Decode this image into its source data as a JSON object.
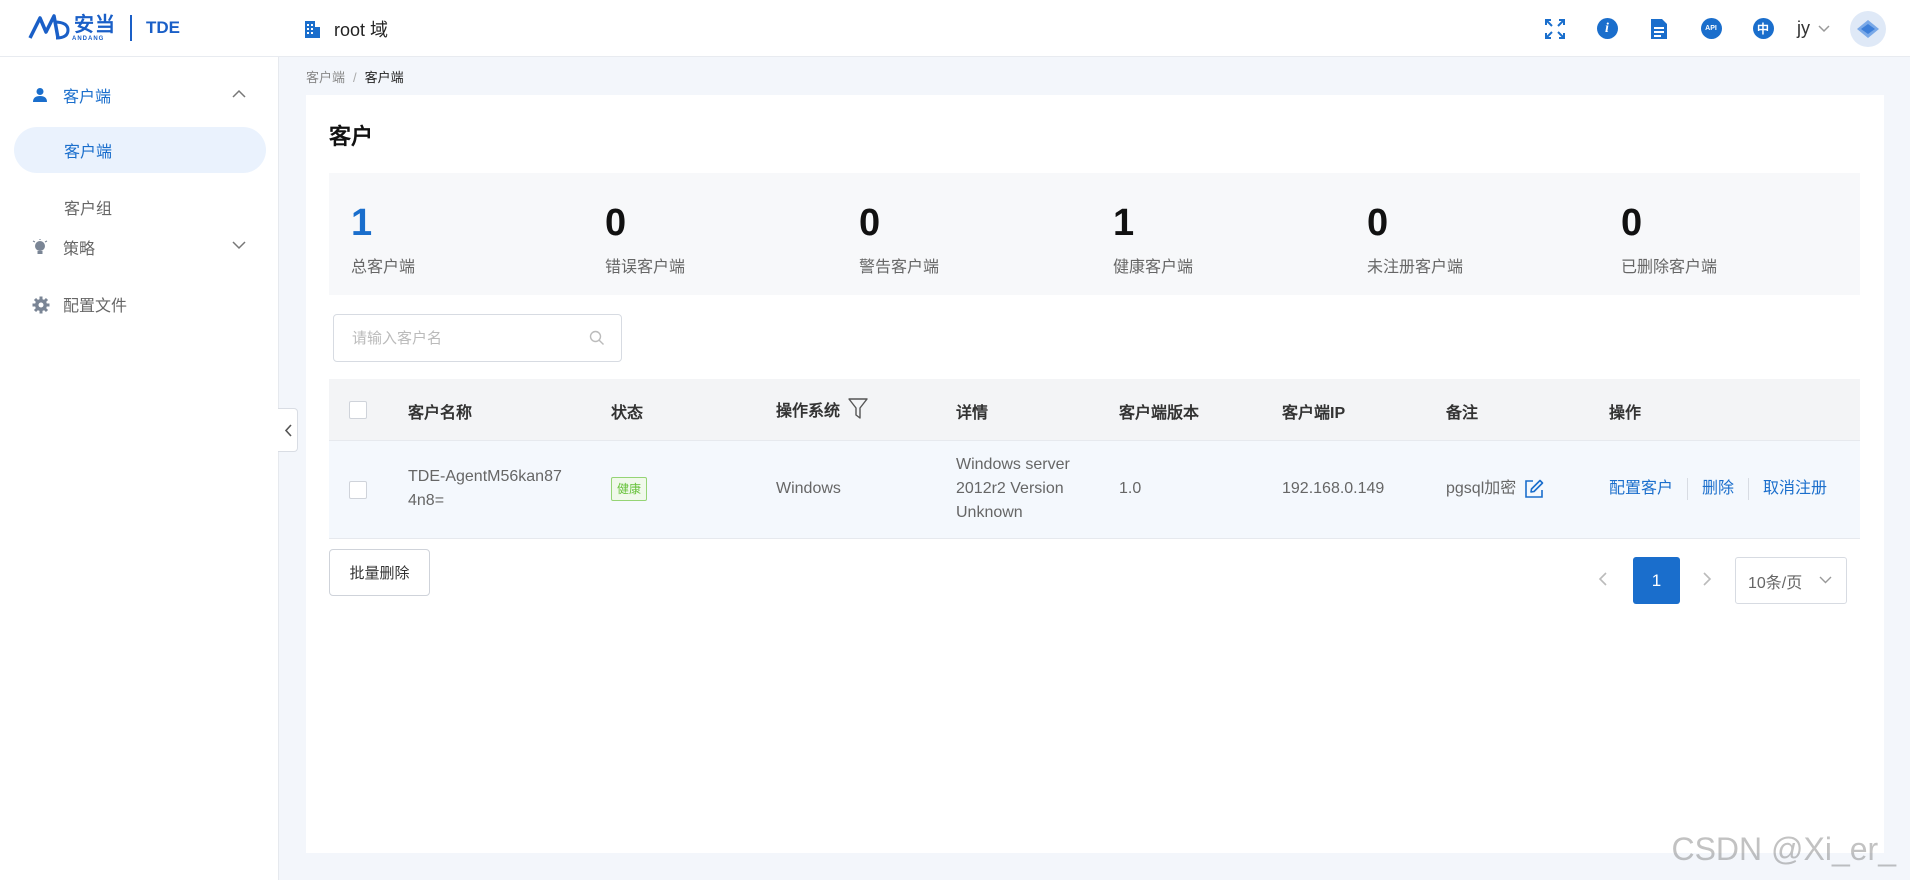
{
  "header": {
    "logo_cn": "安当",
    "logo_en": "ANDANG",
    "product": "TDE",
    "domain": "root 域",
    "icons": [
      "fullscreen-icon",
      "info-icon",
      "document-icon",
      "api-icon",
      "language-icon"
    ],
    "api_label": "API",
    "info_label": "i",
    "lang_label": "中",
    "user": "jy"
  },
  "sidebar": {
    "groups": [
      {
        "label": "客户端",
        "icon": "user-icon",
        "expanded": true,
        "items": [
          {
            "label": "客户端",
            "active": true
          },
          {
            "label": "客户组",
            "active": false
          }
        ]
      },
      {
        "label": "策略",
        "icon": "bulb-icon",
        "expanded": false
      },
      {
        "label": "配置文件",
        "icon": "gear-icon"
      }
    ]
  },
  "breadcrumb": {
    "root": "客户端",
    "sep": "/",
    "current": "客户端"
  },
  "page": {
    "title": "客户"
  },
  "stats": [
    {
      "value": "1",
      "label": "总客户端"
    },
    {
      "value": "0",
      "label": "错误客户端"
    },
    {
      "value": "0",
      "label": "警告客户端"
    },
    {
      "value": "1",
      "label": "健康客户端"
    },
    {
      "value": "0",
      "label": "未注册客户端"
    },
    {
      "value": "0",
      "label": "已删除客户端"
    }
  ],
  "search": {
    "placeholder": "请输入客户名",
    "value": ""
  },
  "table": {
    "columns": [
      "客户名称",
      "状态",
      "操作系统",
      "详情",
      "客户端版本",
      "客户端IP",
      "备注",
      "操作"
    ],
    "rows": [
      {
        "name": "TDE-AgentM56kan874n8=",
        "name_line1": "TDE-AgentM56kan87",
        "name_line2": "4n8=",
        "status": "健康",
        "status_color": "#67c23a",
        "os": "Windows",
        "detail_line1": "Windows server",
        "detail_line2": "2012r2 Version",
        "detail_line3": "Unknown",
        "version": "1.0",
        "ip": "192.168.0.149",
        "remark": "pgsql加密",
        "actions": [
          "配置客户",
          "删除",
          "取消注册"
        ]
      }
    ]
  },
  "footer": {
    "batch_delete": "批量删除"
  },
  "pagination": {
    "current": "1",
    "page_size": "10条/页"
  },
  "watermark": "CSDN @Xi_er_",
  "colors": {
    "primary": "#1a6ecc",
    "success": "#67c23a"
  }
}
